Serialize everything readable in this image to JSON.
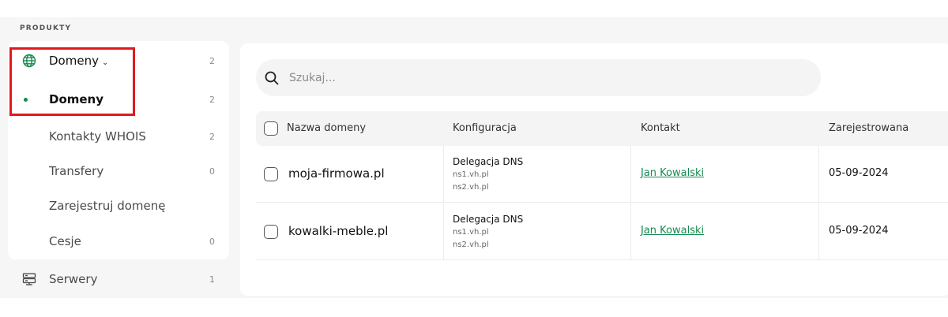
{
  "section_label": "PRODUKTY",
  "sidebar": {
    "items": [
      {
        "label": "Domeny",
        "count": "2",
        "icon": "globe-icon",
        "expanded": true
      },
      {
        "label": "Domeny",
        "count": "2",
        "active": true
      },
      {
        "label": "Kontakty WHOIS",
        "count": "2"
      },
      {
        "label": "Transfery",
        "count": "0"
      },
      {
        "label": "Zarejestruj domenę",
        "count": ""
      },
      {
        "label": "Cesje",
        "count": "0"
      },
      {
        "label": "Serwery",
        "count": "1",
        "icon": "server-icon"
      }
    ]
  },
  "search": {
    "placeholder": "Szukaj..."
  },
  "table": {
    "headers": [
      "Nazwa domeny",
      "Konfiguracja",
      "Kontakt",
      "Zarejestrowana"
    ],
    "rows": [
      {
        "domain": "moja-firmowa.pl",
        "config": "Delegacja DNS",
        "ns1": "ns1.vh.pl",
        "ns2": "ns2.vh.pl",
        "contact": "Jan Kowalski",
        "registered": "05-09-2024"
      },
      {
        "domain": "kowalki-meble.pl",
        "config": "Delegacja DNS",
        "ns1": "ns1.vh.pl",
        "ns2": "ns2.vh.pl",
        "contact": "Jan Kowalski",
        "registered": "05-09-2024"
      }
    ]
  },
  "colors": {
    "accent": "#148a4e",
    "highlight": "#e0191f"
  }
}
